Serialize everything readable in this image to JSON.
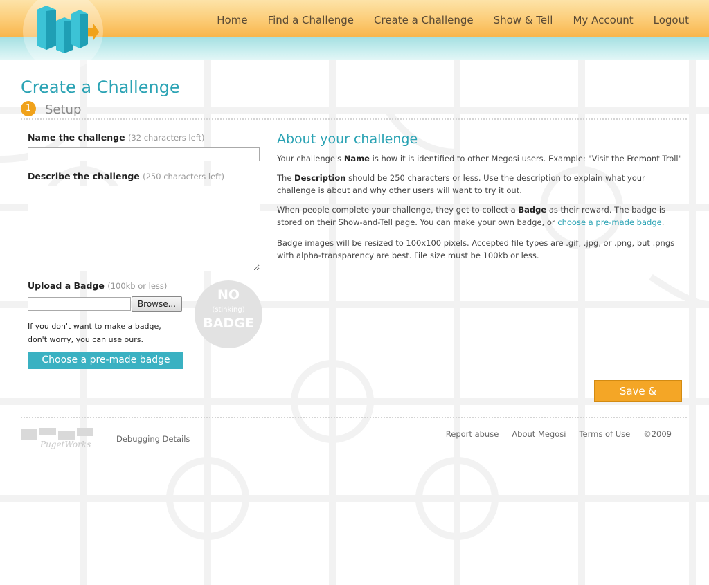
{
  "nav": {
    "items": [
      "Home",
      "Find a Challenge",
      "Create a Challenge",
      "Show & Tell",
      "My Account",
      "Logout"
    ]
  },
  "page": {
    "title": "Create a Challenge",
    "step_number": "1",
    "step_label": "Setup"
  },
  "form": {
    "name_label": "Name the challenge",
    "name_hint": "(32 characters left)",
    "name_value": "",
    "describe_label": "Describe the challenge",
    "describe_hint": "(250 characters left)",
    "describe_value": "",
    "upload_label": "Upload a Badge",
    "upload_hint": "(100kb or less)",
    "browse_label": "Browse...",
    "badge_note": "If you don't want to make a badge, don't worry, you can use ours.",
    "no_badge": {
      "line1": "NO",
      "line2": "(stinking)",
      "line3": "BADGE"
    },
    "premade_button": "Choose a pre-made badge",
    "save_button": "Save & Continue"
  },
  "about": {
    "title": "About your challenge",
    "p1_a": "Your challenge's ",
    "p1_b": "Name",
    "p1_c": " is how it is identified to other Megosi users. Example: \"Visit the Fremont Troll\"",
    "p2_a": "The ",
    "p2_b": "Description",
    "p2_c": " should be 250 characters or less. Use the description to explain what your challenge is about and why other users will want to try it out.",
    "p3_a": "When people complete your challenge, they get to collect a ",
    "p3_b": "Badge",
    "p3_c": " as their reward. The badge is stored on their Show-and-Tell page. You can make your own badge, or ",
    "p3_link": "choose a pre-made badge",
    "p3_d": ".",
    "p4": "Badge images will be resized to 100x100 pixels. Accepted file types are .gif, .jpg, or .png, but .pngs with alpha-transparency are best. File size must be 100kb or less."
  },
  "footer": {
    "logo_text": "PugetWorks",
    "debug_link": "Debugging Details",
    "links": [
      "Report abuse",
      "About Megosi",
      "Terms of Use"
    ],
    "copyright": "©2009"
  },
  "colors": {
    "accent_teal": "#2ba3b4",
    "button_teal": "#3ab1c2",
    "accent_orange": "#f4a626",
    "header_orange": "#fcd07f",
    "header_teal": "#a6e0e2"
  }
}
